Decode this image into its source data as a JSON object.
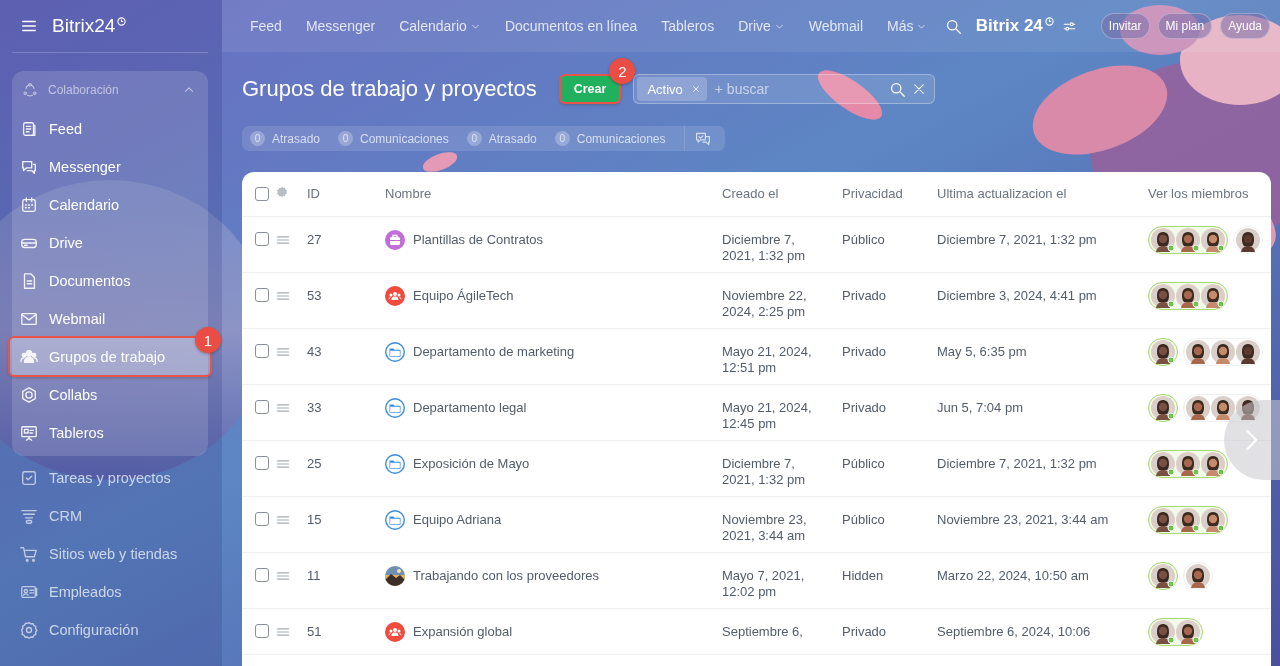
{
  "sidebar": {
    "logo": "Bitrix24",
    "group": {
      "label": "Colaboración",
      "expanded": true,
      "items": [
        {
          "label": "Feed",
          "kind": "feed",
          "selected": false,
          "highlighted": false
        },
        {
          "label": "Messenger",
          "kind": "messenger",
          "selected": false,
          "highlighted": false
        },
        {
          "label": "Calendario",
          "kind": "calendar",
          "selected": false,
          "highlighted": false
        },
        {
          "label": "Drive",
          "kind": "drive",
          "selected": false,
          "highlighted": false
        },
        {
          "label": "Documentos",
          "kind": "documents",
          "selected": false,
          "highlighted": false
        },
        {
          "label": "Webmail",
          "kind": "webmail",
          "selected": false,
          "highlighted": false
        },
        {
          "label": "Grupos de trabajo",
          "kind": "groups",
          "selected": true,
          "highlighted": true,
          "callout": "1"
        },
        {
          "label": "Collabs",
          "kind": "collabs",
          "selected": false,
          "highlighted": false
        },
        {
          "label": "Tableros",
          "kind": "boards",
          "selected": false,
          "highlighted": false
        }
      ]
    },
    "items": [
      {
        "label": "Tareas y proyectos",
        "kind": "tasks",
        "selected": false,
        "highlighted": false
      },
      {
        "label": "CRM",
        "kind": "crm",
        "selected": false,
        "highlighted": false
      },
      {
        "label": "Sitios web y tiendas",
        "kind": "sites",
        "selected": false,
        "highlighted": false
      },
      {
        "label": "Empleados",
        "kind": "employees",
        "selected": false,
        "highlighted": false
      },
      {
        "label": "Configuración",
        "kind": "settings",
        "selected": false,
        "highlighted": false
      }
    ]
  },
  "header": {
    "nav": [
      {
        "label": "Feed",
        "dropdown": false
      },
      {
        "label": "Messenger",
        "dropdown": false
      },
      {
        "label": "Calendario",
        "dropdown": true
      },
      {
        "label": "Documentos en línea",
        "dropdown": false
      },
      {
        "label": "Tableros",
        "dropdown": false
      },
      {
        "label": "Drive",
        "dropdown": true
      },
      {
        "label": "Webmail",
        "dropdown": false
      },
      {
        "label": "Más",
        "dropdown": true
      }
    ],
    "logo": "Bitrix 24",
    "buttons": [
      "Invitar",
      "Mi plan",
      "Ayuda"
    ]
  },
  "page": {
    "title": "Grupos de trabajo y proyectos",
    "create_button": {
      "label": "Crear",
      "highlighted": true,
      "callout": "2"
    },
    "filter": {
      "chips": [
        "Activo"
      ],
      "placeholder": "+ buscar"
    },
    "counters": [
      {
        "count": "0",
        "label": "Atrasado"
      },
      {
        "count": "0",
        "label": "Comunicaciones"
      },
      {
        "count": "0",
        "label": "Atrasado"
      },
      {
        "count": "0",
        "label": "Comunicaciones"
      }
    ]
  },
  "table": {
    "all_checked": false,
    "columns": [
      "ID",
      "Nombre",
      "Creado el",
      "Privacidad",
      "Ultima actualizacion el",
      "Ver los miembros"
    ],
    "rows": [
      {
        "checked": false,
        "id": "27",
        "kind": "briefcase",
        "name": "Plantillas de Contratos",
        "created": "Diciembre 7, 2021, 1:32 pm",
        "privacy": "Público",
        "updated": "Diciembre 7, 2021, 1:32 pm",
        "members": [
          {
            "kind": "employee"
          },
          {
            "kind": "employee"
          },
          {
            "kind": "employee"
          },
          {
            "kind": "guest"
          }
        ]
      },
      {
        "checked": false,
        "id": "53",
        "kind": "team",
        "name": "Equipo ÁgileTech",
        "created": "Noviembre 22, 2024, 2:25 pm",
        "privacy": "Privado",
        "updated": "Diciembre 3, 2024, 4:41 pm",
        "members": [
          {
            "kind": "employee"
          },
          {
            "kind": "employee"
          },
          {
            "kind": "employee"
          }
        ]
      },
      {
        "checked": false,
        "id": "43",
        "kind": "folder",
        "name": "Departamento de marketing",
        "created": "Mayo 21, 2024, 12:51 pm",
        "privacy": "Privado",
        "updated": "May 5, 6:35 pm",
        "members": [
          {
            "kind": "employee"
          },
          {
            "kind": "guest"
          },
          {
            "kind": "guest"
          },
          {
            "kind": "guest"
          }
        ]
      },
      {
        "checked": false,
        "id": "33",
        "kind": "folder",
        "name": "Departamento legal",
        "created": "Mayo 21, 2024, 12:45 pm",
        "privacy": "Privado",
        "updated": "Jun 5, 7:04 pm",
        "members": [
          {
            "kind": "employee"
          },
          {
            "kind": "guest"
          },
          {
            "kind": "guest"
          },
          {
            "kind": "guest"
          }
        ]
      },
      {
        "checked": false,
        "id": "25",
        "kind": "folder",
        "name": "Exposición de Mayo",
        "created": "Diciembre 7, 2021, 1:32 pm",
        "privacy": "Público",
        "updated": "Diciembre 7, 2021, 1:32 pm",
        "members": [
          {
            "kind": "employee"
          },
          {
            "kind": "employee"
          },
          {
            "kind": "employee"
          }
        ]
      },
      {
        "checked": false,
        "id": "15",
        "kind": "folder",
        "name": "Equipo Adriana",
        "created": "Noviembre 23, 2021, 3:44 am",
        "privacy": "Público",
        "updated": "Noviembre 23, 2021, 3:44 am",
        "members": [
          {
            "kind": "employee"
          },
          {
            "kind": "employee"
          },
          {
            "kind": "employee"
          }
        ]
      },
      {
        "checked": false,
        "id": "11",
        "name": "Trabajando con los proveedores",
        "created": "Mayo 7, 2021, 12:02 pm",
        "privacy": "Hidden",
        "updated": "Marzo 22, 2024, 10:50 am",
        "members": [
          {
            "kind": "employee"
          },
          {
            "kind": "guest"
          }
        ]
      },
      {
        "checked": false,
        "id": "51",
        "kind": "team",
        "name": "Expansión global",
        "created": "Septiembre 6,",
        "privacy": "Privado",
        "updated": "Septiembre 6, 2024, 10:06",
        "members": [
          {
            "kind": "employee"
          },
          {
            "kind": "employee"
          }
        ]
      }
    ]
  }
}
